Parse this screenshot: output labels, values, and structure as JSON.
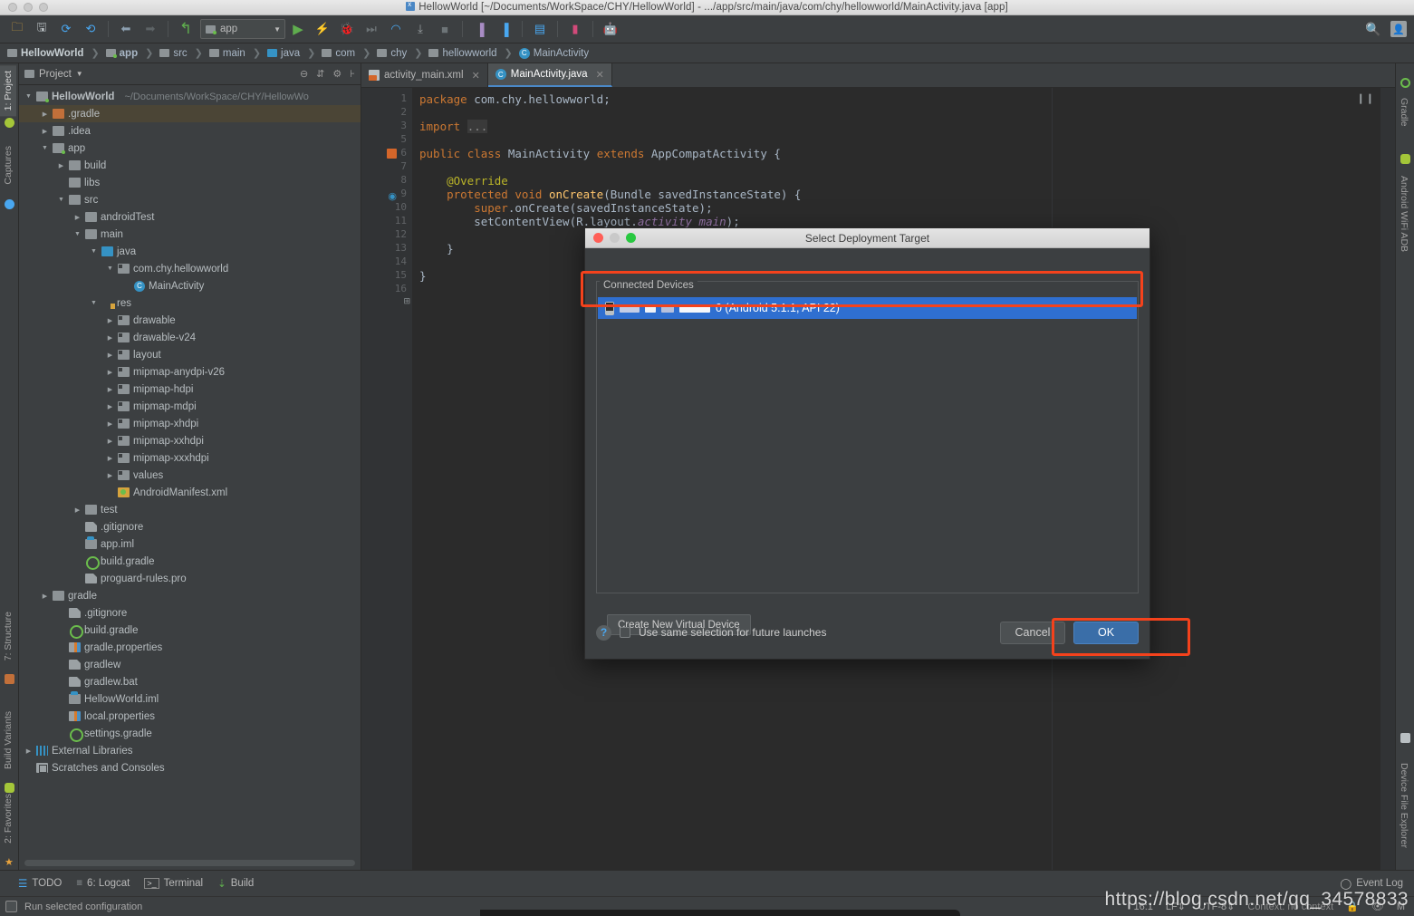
{
  "window": {
    "title": "HellowWorld [~/Documents/WorkSpace/CHY/HellowWorld] - .../app/src/main/java/com/chy/hellowworld/MainActivity.java [app]",
    "title_icon": "idea-file-icon"
  },
  "toolbar": {
    "module_selector": "app",
    "icons": [
      "open-folder-icon",
      "save-all-icon",
      "sync-icon",
      "refresh-project-icon",
      "back-icon",
      "forward-icon",
      "undo-icon"
    ],
    "run_icons": [
      "run-icon",
      "apply-changes-icon",
      "debug-icon",
      "step-icon",
      "profiler-icon",
      "attach-debugger-icon",
      "stop-icon"
    ],
    "android_icons": [
      "sdk-manager-icon",
      "avd-manager-icon",
      "resource-manager-icon",
      "device-monitor-icon",
      "android-wifi-adb-icon"
    ],
    "right_icons": [
      "search-icon",
      "avatar-icon"
    ]
  },
  "breadcrumb": [
    {
      "label": "HellowWorld",
      "icon": "module-icon"
    },
    {
      "label": "app",
      "icon": "module-green-icon"
    },
    {
      "label": "src",
      "icon": "folder-icon"
    },
    {
      "label": "main",
      "icon": "folder-icon"
    },
    {
      "label": "java",
      "icon": "folder-blue-icon"
    },
    {
      "label": "com",
      "icon": "package-icon"
    },
    {
      "label": "chy",
      "icon": "package-icon"
    },
    {
      "label": "hellowworld",
      "icon": "package-icon"
    },
    {
      "label": "MainActivity",
      "icon": "class-icon"
    }
  ],
  "left_strip": {
    "top": [
      {
        "label": "1: Project",
        "icon": "project-icon",
        "active": true
      },
      {
        "label": "Captures",
        "icon": "captures-icon",
        "active": false
      }
    ],
    "bottom": [
      {
        "label": "7: Structure",
        "icon": "structure-icon"
      },
      {
        "label": "Build Variants",
        "icon": "android-icon"
      },
      {
        "label": "2: Favorites",
        "icon": "star-icon"
      }
    ]
  },
  "right_strip": {
    "top": [
      {
        "label": "Gradle",
        "icon": "gradle-icon"
      },
      {
        "label": "Android WiFi ADB",
        "icon": "android-icon"
      }
    ],
    "bottom": [
      {
        "label": "Device File Explorer",
        "icon": "device-icon"
      }
    ]
  },
  "project_panel": {
    "header": "Project",
    "header_icons": [
      "collapse-all-icon",
      "expand-all-icon",
      "settings-icon",
      "hide-icon"
    ],
    "root_path": "~/Documents/WorkSpace/CHY/HellowWo",
    "tree": [
      {
        "label": "HellowWorld",
        "depth": 0,
        "arrow": "down",
        "icon": "module",
        "selected": false,
        "path": true
      },
      {
        "label": ".gradle",
        "depth": 1,
        "arrow": "right",
        "icon": "folderO",
        "selected": true
      },
      {
        "label": ".idea",
        "depth": 1,
        "arrow": "right",
        "icon": "folder",
        "selected": false
      },
      {
        "label": "app",
        "depth": 1,
        "arrow": "down",
        "icon": "module",
        "selected": false
      },
      {
        "label": "build",
        "depth": 2,
        "arrow": "right",
        "icon": "folder",
        "selected": false
      },
      {
        "label": "libs",
        "depth": 2,
        "arrow": "none",
        "icon": "folder",
        "selected": false
      },
      {
        "label": "src",
        "depth": 2,
        "arrow": "down",
        "icon": "folder",
        "selected": false
      },
      {
        "label": "androidTest",
        "depth": 3,
        "arrow": "right",
        "icon": "folder",
        "selected": false
      },
      {
        "label": "main",
        "depth": 3,
        "arrow": "down",
        "icon": "folder",
        "selected": false
      },
      {
        "label": "java",
        "depth": 4,
        "arrow": "down",
        "icon": "folderB",
        "selected": false
      },
      {
        "label": "com.chy.hellowworld",
        "depth": 5,
        "arrow": "down",
        "icon": "pkg",
        "selected": false
      },
      {
        "label": "MainActivity",
        "depth": 6,
        "arrow": "none",
        "icon": "cls",
        "selected": false
      },
      {
        "label": "res",
        "depth": 4,
        "arrow": "down",
        "icon": "res",
        "selected": false
      },
      {
        "label": "drawable",
        "depth": 5,
        "arrow": "right",
        "icon": "pkg",
        "selected": false
      },
      {
        "label": "drawable-v24",
        "depth": 5,
        "arrow": "right",
        "icon": "pkg",
        "selected": false
      },
      {
        "label": "layout",
        "depth": 5,
        "arrow": "right",
        "icon": "pkg",
        "selected": false
      },
      {
        "label": "mipmap-anydpi-v26",
        "depth": 5,
        "arrow": "right",
        "icon": "pkg",
        "selected": false
      },
      {
        "label": "mipmap-hdpi",
        "depth": 5,
        "arrow": "right",
        "icon": "pkg",
        "selected": false
      },
      {
        "label": "mipmap-mdpi",
        "depth": 5,
        "arrow": "right",
        "icon": "pkg",
        "selected": false
      },
      {
        "label": "mipmap-xhdpi",
        "depth": 5,
        "arrow": "right",
        "icon": "pkg",
        "selected": false
      },
      {
        "label": "mipmap-xxhdpi",
        "depth": 5,
        "arrow": "right",
        "icon": "pkg",
        "selected": false
      },
      {
        "label": "mipmap-xxxhdpi",
        "depth": 5,
        "arrow": "right",
        "icon": "pkg",
        "selected": false
      },
      {
        "label": "values",
        "depth": 5,
        "arrow": "right",
        "icon": "pkg",
        "selected": false
      },
      {
        "label": "AndroidManifest.xml",
        "depth": 5,
        "arrow": "none",
        "icon": "manifest",
        "selected": false
      },
      {
        "label": "test",
        "depth": 3,
        "arrow": "right",
        "icon": "folder",
        "selected": false
      },
      {
        "label": ".gitignore",
        "depth": 3,
        "arrow": "none",
        "icon": "file",
        "selected": false
      },
      {
        "label": "app.iml",
        "depth": 3,
        "arrow": "none",
        "icon": "imlfile",
        "selected": false
      },
      {
        "label": "build.gradle",
        "depth": 3,
        "arrow": "none",
        "icon": "gradlefile",
        "selected": false
      },
      {
        "label": "proguard-rules.pro",
        "depth": 3,
        "arrow": "none",
        "icon": "file",
        "selected": false
      },
      {
        "label": "gradle",
        "depth": 1,
        "arrow": "right",
        "icon": "folder",
        "selected": false
      },
      {
        "label": ".gitignore",
        "depth": 2,
        "arrow": "none",
        "icon": "file",
        "selected": false
      },
      {
        "label": "build.gradle",
        "depth": 2,
        "arrow": "none",
        "icon": "gradlefile",
        "selected": false
      },
      {
        "label": "gradle.properties",
        "depth": 2,
        "arrow": "none",
        "icon": "props",
        "selected": false
      },
      {
        "label": "gradlew",
        "depth": 2,
        "arrow": "none",
        "icon": "file",
        "selected": false
      },
      {
        "label": "gradlew.bat",
        "depth": 2,
        "arrow": "none",
        "icon": "file",
        "selected": false
      },
      {
        "label": "HellowWorld.iml",
        "depth": 2,
        "arrow": "none",
        "icon": "imlfile",
        "selected": false
      },
      {
        "label": "local.properties",
        "depth": 2,
        "arrow": "none",
        "icon": "props",
        "selected": false
      },
      {
        "label": "settings.gradle",
        "depth": 2,
        "arrow": "none",
        "icon": "gradlefile",
        "selected": false
      },
      {
        "label": "External Libraries",
        "depth": 0,
        "arrow": "right",
        "icon": "libs",
        "selected": false
      },
      {
        "label": "Scratches and Consoles",
        "depth": 0,
        "arrow": "none",
        "icon": "scratch",
        "selected": false
      }
    ]
  },
  "editor": {
    "tabs": [
      {
        "label": "activity_main.xml",
        "icon": "xml-layout-icon",
        "active": false
      },
      {
        "label": "MainActivity.java",
        "icon": "class-icon",
        "active": true
      }
    ],
    "line_numbers": [
      "1",
      "2",
      "3",
      "5",
      "6",
      "7",
      "8",
      "9",
      "10",
      "11",
      "12",
      "13",
      "14",
      "15",
      "16"
    ],
    "code_lines": [
      [
        {
          "t": "package ",
          "c": "k"
        },
        {
          "t": "com.chy.hellowworld",
          "c": ""
        },
        {
          "t": ";",
          "c": ""
        }
      ],
      [],
      [
        {
          "t": "import ",
          "c": "k"
        },
        {
          "t": "...",
          "c": "fold"
        }
      ],
      [],
      [
        {
          "t": "public ",
          "c": "k"
        },
        {
          "t": "class ",
          "c": "k"
        },
        {
          "t": "MainActivity ",
          "c": ""
        },
        {
          "t": "extends ",
          "c": "k"
        },
        {
          "t": "AppCompatActivity {",
          "c": ""
        }
      ],
      [],
      [
        {
          "t": "    @Override",
          "c": "an"
        }
      ],
      [
        {
          "t": "    protected ",
          "c": "k"
        },
        {
          "t": "void ",
          "c": "k"
        },
        {
          "t": "onCreate",
          "c": "f"
        },
        {
          "t": "(Bundle savedInstanceState) {",
          "c": ""
        }
      ],
      [
        {
          "t": "        super",
          "c": "k"
        },
        {
          "t": ".onCreate(savedInstanceState);",
          "c": ""
        }
      ],
      [
        {
          "t": "        setContentView(R.layout.",
          "c": ""
        },
        {
          "t": "activity_main",
          "c": "fi"
        },
        {
          "t": ");",
          "c": ""
        }
      ],
      [],
      [
        {
          "t": "    }",
          "c": ""
        }
      ],
      [],
      [
        {
          "t": "}",
          "c": ""
        }
      ],
      []
    ]
  },
  "dialog": {
    "title": "Select Deployment Target",
    "group_label": "Connected Devices",
    "device": {
      "name_redacted": true,
      "suffix": "0 (Android 5.1.1, API 22)",
      "selected": true
    },
    "create_virtual_device_button": "Create New Virtual Device",
    "help_icon": "?",
    "checkbox_label": "Use same selection for future launches",
    "checkbox_checked": false,
    "cancel_button": "Cancel",
    "ok_button": "OK",
    "accent_color": "#3a6ea8",
    "annotation_color": "#f4421c"
  },
  "bottom_bar": {
    "items": [
      {
        "label": "TODO",
        "icon": "todo-icon"
      },
      {
        "label": "6: Logcat",
        "icon": "logcat-icon"
      },
      {
        "label": "Terminal",
        "icon": "terminal-icon"
      },
      {
        "label": "Build",
        "icon": "build-icon"
      }
    ],
    "event_log": "Event Log",
    "event_log_icon": "bell-icon"
  },
  "status_bar": {
    "run_text": "Run selected configuration",
    "caret": "16:1",
    "line_sep": "LF",
    "encoding": "UTF-8",
    "context": "Context: no context",
    "memory": "M"
  },
  "watermark": "https://blog.csdn.net/qq_34578833"
}
